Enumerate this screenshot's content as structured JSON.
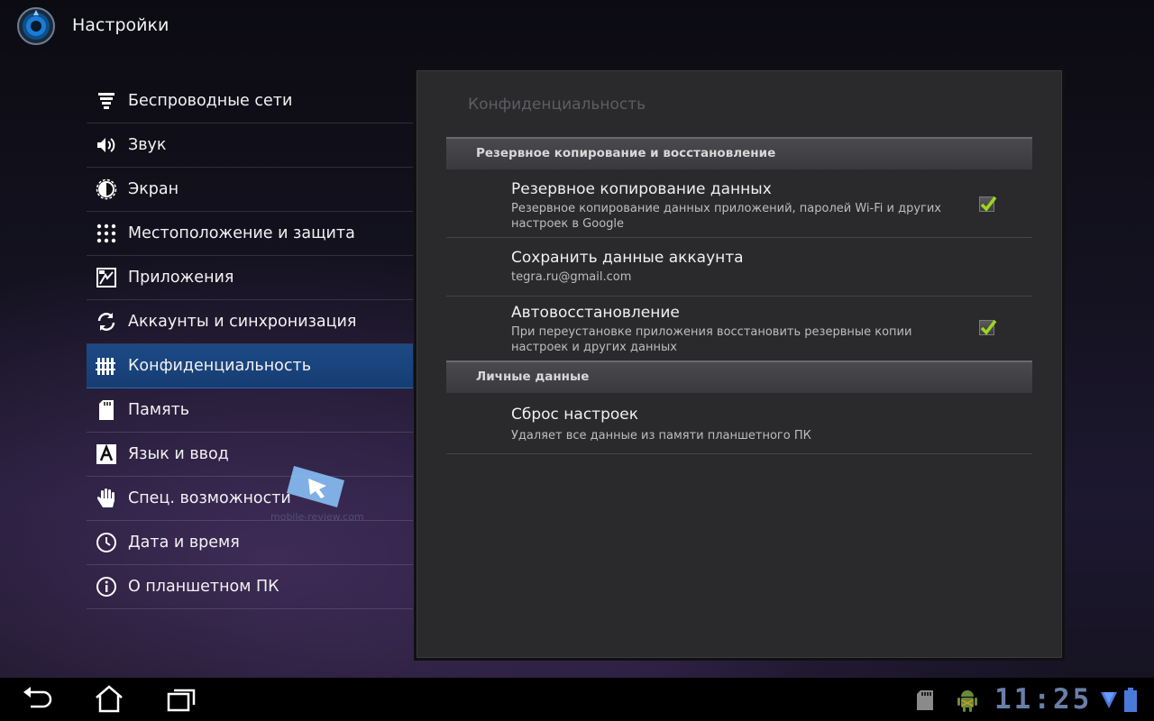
{
  "actionbar": {
    "title": "Настройки",
    "app_icon": "settings-app-icon"
  },
  "nav": {
    "items": [
      {
        "label": "Беспроводные сети",
        "icon": "wifi-icon"
      },
      {
        "label": "Звук",
        "icon": "speaker-icon"
      },
      {
        "label": "Экран",
        "icon": "brightness-icon"
      },
      {
        "label": "Местоположение и защита",
        "icon": "pattern-lock-icon"
      },
      {
        "label": "Приложения",
        "icon": "applications-icon"
      },
      {
        "label": "Аккаунты и синхронизация",
        "icon": "sync-icon"
      },
      {
        "label": "Конфиденциальность",
        "icon": "privacy-fence-icon",
        "selected": true
      },
      {
        "label": "Память",
        "icon": "sd-card-icon"
      },
      {
        "label": "Язык и ввод",
        "icon": "language-icon"
      },
      {
        "label": "Спец. возможности",
        "icon": "hand-icon"
      },
      {
        "label": "Дата и время",
        "icon": "clock-icon"
      },
      {
        "label": "О планшетном ПК",
        "icon": "info-icon"
      }
    ]
  },
  "panel": {
    "title": "Конфиденциальность",
    "sections": [
      {
        "header": "Резервное копирование и восстановление",
        "prefs": [
          {
            "title": "Резервное копирование данных",
            "summary": "Резервное копирование данных приложений, паролей Wi-Fi и других настроек в Google",
            "checked": true
          },
          {
            "title": "Сохранить данные аккаунта",
            "summary": "tegra.ru@gmail.com",
            "checked": null
          },
          {
            "title": "Автовосстановление",
            "summary": "При переустановке приложения восстановить резервные копии настроек и других данных",
            "checked": true
          }
        ]
      },
      {
        "header": "Личные данные",
        "prefs": [
          {
            "title": "Сброс настроек",
            "summary": "Удаляет все данные из памяти планшетного ПК",
            "checked": null
          }
        ]
      }
    ]
  },
  "watermark": {
    "text": "mobile-review.com"
  },
  "sysbar": {
    "clock": "11:25",
    "buttons": [
      "back-icon",
      "home-icon",
      "recent-apps-icon"
    ],
    "status_icons": [
      "sd-card-status-icon",
      "android-debug-icon",
      "wifi-signal-icon",
      "battery-icon"
    ]
  },
  "colors": {
    "accent": "#1c4a86",
    "check": "#9ad81f",
    "panel": "#2a2a2c"
  }
}
